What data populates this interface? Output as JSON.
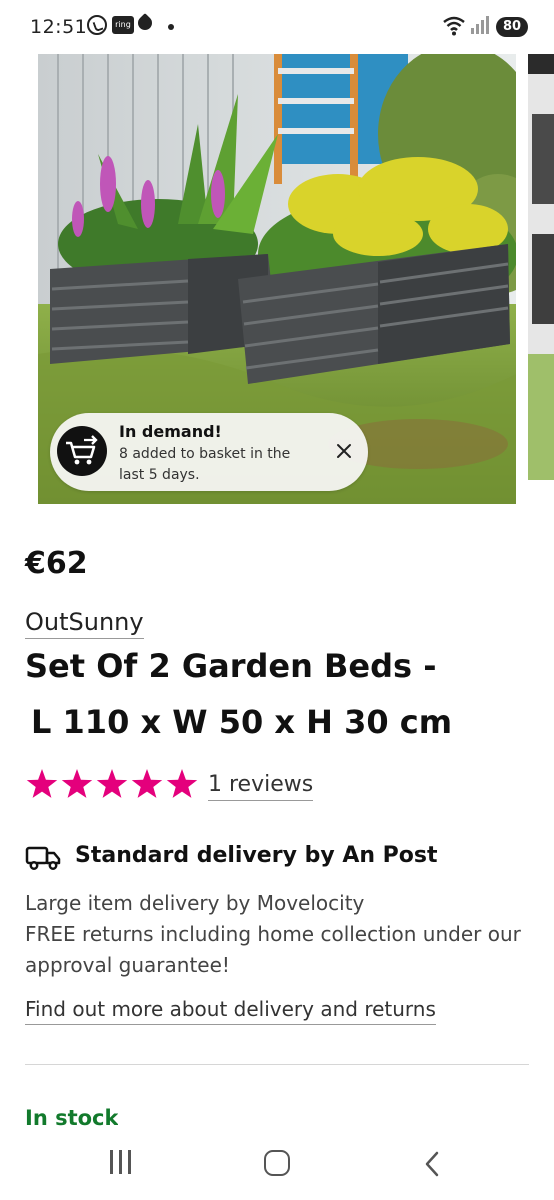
{
  "status_bar": {
    "time": "12:51",
    "ring_label": "ring",
    "battery": "80"
  },
  "product": {
    "price": "€62",
    "brand": "OutSunny",
    "title_line1": "Set Of 2 Garden Beds -",
    "title_line2": "L 110 x W 50 x H 30 cm",
    "rating_stars": 5,
    "reviews_label": "1 reviews"
  },
  "demand_banner": {
    "title": "In demand!",
    "text": "8 added to basket in the last 5 days."
  },
  "delivery": {
    "title": "Standard delivery by An Post",
    "line1": "Large item delivery by Movelocity",
    "line2": "FREE returns including home collection under our",
    "line3": "approval guarantee!",
    "link": "Find out more about delivery and returns"
  },
  "stock": {
    "status": "In stock"
  },
  "colors": {
    "star": "#e4007c",
    "stock_green": "#127a2c",
    "bed_metal": "#4a4d4f"
  },
  "icons": [
    "whatsapp-icon",
    "ring-app-icon",
    "wifi-icon",
    "signal-icon",
    "basket-trend-icon",
    "close-icon",
    "star-icon",
    "delivery-truck-icon",
    "recent-apps-icon",
    "home-icon",
    "back-icon"
  ]
}
